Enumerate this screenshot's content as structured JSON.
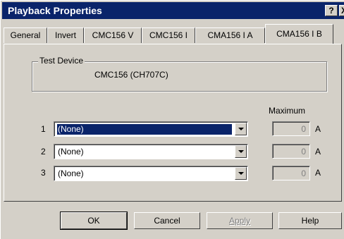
{
  "window": {
    "title": "Playback Properties",
    "help_glyph": "?",
    "close_glyph": "X"
  },
  "tabs": [
    {
      "label": "General",
      "active": false
    },
    {
      "label": "Invert",
      "active": false
    },
    {
      "label": "CMC156 V",
      "active": false
    },
    {
      "label": "CMC156 I",
      "active": false
    },
    {
      "label": "CMA156 I A",
      "active": false
    },
    {
      "label": "CMA156 I B",
      "active": true
    }
  ],
  "test_device": {
    "label": "Test Device",
    "value": "CMC156 (CH707C)"
  },
  "maximum_header": "Maximum",
  "rows": [
    {
      "number": "1",
      "selection": "(None)",
      "maximum": "0",
      "unit": "A"
    },
    {
      "number": "2",
      "selection": "(None)",
      "maximum": "0",
      "unit": "A"
    },
    {
      "number": "3",
      "selection": "(None)",
      "maximum": "0",
      "unit": "A"
    }
  ],
  "buttons": {
    "ok": "OK",
    "cancel": "Cancel",
    "apply": "Apply",
    "help": "Help"
  },
  "colors": {
    "titlebar": "#0a246a",
    "face": "#d4d0c8",
    "selection": "#0a246a"
  }
}
